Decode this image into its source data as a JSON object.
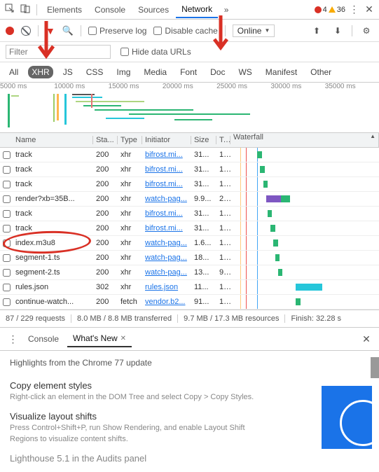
{
  "top_tabs": [
    "Elements",
    "Console",
    "Sources",
    "Network"
  ],
  "active_top_tab": "Network",
  "errors": {
    "red": "4",
    "yellow": "36"
  },
  "toolbar": {
    "preserve": "Preserve log",
    "disable": "Disable cache",
    "throttle": "Online"
  },
  "filter": {
    "placeholder": "Filter",
    "hide": "Hide data URLs"
  },
  "types": [
    "All",
    "XHR",
    "JS",
    "CSS",
    "Img",
    "Media",
    "Font",
    "Doc",
    "WS",
    "Manifest",
    "Other"
  ],
  "active_type": "XHR",
  "timeline": [
    "5000 ms",
    "10000 ms",
    "15000 ms",
    "20000 ms",
    "25000 ms",
    "30000 ms",
    "35000 ms"
  ],
  "columns": [
    "Name",
    "Sta...",
    "Type",
    "Initiator",
    "Size",
    "T...",
    "Waterfall"
  ],
  "rows": [
    {
      "name": "track",
      "status": "200",
      "type": "xhr",
      "init": "bifrost.mi...",
      "size": "31...",
      "time": "1...",
      "wf_l": 18,
      "wf_w": 3,
      "wf_c": "#2bb673"
    },
    {
      "name": "track",
      "status": "200",
      "type": "xhr",
      "init": "bifrost.mi...",
      "size": "31...",
      "time": "1...",
      "wf_l": 20,
      "wf_w": 3,
      "wf_c": "#2bb673"
    },
    {
      "name": "track",
      "status": "200",
      "type": "xhr",
      "init": "bifrost.mi...",
      "size": "31...",
      "time": "1...",
      "wf_l": 22,
      "wf_w": 3,
      "wf_c": "#2bb673"
    },
    {
      "name": "render?xb=35B...",
      "status": "200",
      "type": "xhr",
      "init": "watch-pag...",
      "size": "9.9...",
      "time": "2...",
      "wf_l": 24,
      "wf_w": 10,
      "wf_c": "#7e57c2",
      "wf2_l": 34,
      "wf2_w": 6,
      "wf2_c": "#2bb673"
    },
    {
      "name": "track",
      "status": "200",
      "type": "xhr",
      "init": "bifrost.mi...",
      "size": "31...",
      "time": "1...",
      "wf_l": 25,
      "wf_w": 3,
      "wf_c": "#2bb673"
    },
    {
      "name": "track",
      "status": "200",
      "type": "xhr",
      "init": "bifrost.mi...",
      "size": "31...",
      "time": "1...",
      "wf_l": 27,
      "wf_w": 3,
      "wf_c": "#2bb673"
    },
    {
      "name": "index.m3u8",
      "status": "200",
      "type": "xhr",
      "init": "watch-pag...",
      "size": "1.6...",
      "time": "1...",
      "wf_l": 29,
      "wf_w": 3,
      "wf_c": "#2bb673"
    },
    {
      "name": "segment-1.ts",
      "status": "200",
      "type": "xhr",
      "init": "watch-pag...",
      "size": "18...",
      "time": "1...",
      "wf_l": 30,
      "wf_w": 3,
      "wf_c": "#2bb673"
    },
    {
      "name": "segment-2.ts",
      "status": "200",
      "type": "xhr",
      "init": "watch-pag...",
      "size": "13...",
      "time": "9...",
      "wf_l": 32,
      "wf_w": 3,
      "wf_c": "#2bb673"
    },
    {
      "name": "rules.json",
      "status": "302",
      "type": "xhr",
      "init": "rules.json",
      "size": "11...",
      "time": "1...",
      "wf_l": 44,
      "wf_w": 18,
      "wf_c": "#26c6da"
    },
    {
      "name": "continue-watch...",
      "status": "200",
      "type": "fetch",
      "init": "vendor.b2...",
      "size": "91...",
      "time": "1...",
      "wf_l": 44,
      "wf_w": 3,
      "wf_c": "#2bb673"
    }
  ],
  "status": {
    "req": "87 / 229 requests",
    "xfer": "8.0 MB / 8.8 MB transferred",
    "res": "9.7 MB / 17.3 MB resources",
    "finish": "Finish: 32.28 s"
  },
  "drawer": {
    "tabs": [
      "Console",
      "What's New"
    ],
    "active": "What's New",
    "heading": "Highlights from the Chrome 77 update",
    "sections": [
      {
        "h": "Copy element styles",
        "p": "Right-click an element in the DOM Tree and select Copy > Copy Styles."
      },
      {
        "h": "Visualize layout shifts",
        "p": "Press Control+Shift+P, run Show Rendering, and enable Layout Shift Regions to visualize content shifts."
      },
      {
        "h": "Lighthouse 5.1 in the Audits panel",
        "p": ""
      }
    ]
  }
}
